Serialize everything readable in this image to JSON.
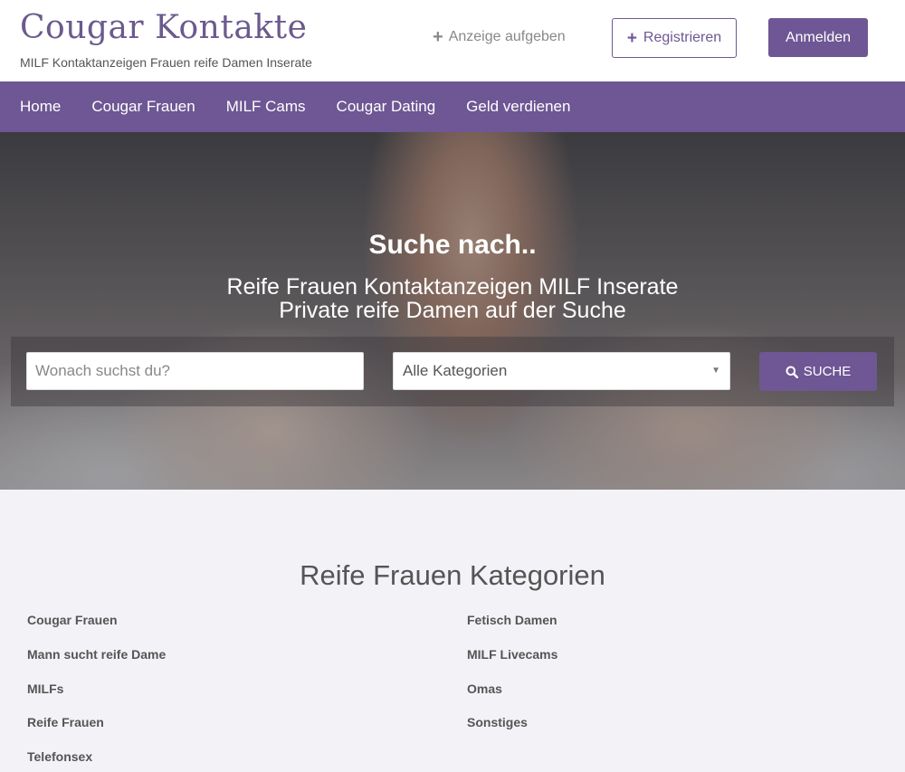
{
  "header": {
    "title": "Cougar Kontakte",
    "tagline": "MILF Kontaktanzeigen Frauen reife Damen Inserate",
    "post_ad_label": "Anzeige aufgeben",
    "register_label": "Registrieren",
    "login_label": "Anmelden"
  },
  "nav": {
    "items": [
      "Home",
      "Cougar Frauen",
      "MILF Cams",
      "Cougar Dating",
      "Geld verdienen"
    ]
  },
  "hero": {
    "title": "Suche nach..",
    "line1": "Reife Frauen Kontaktanzeigen MILF Inserate",
    "line2": "Private reife Damen auf der Suche",
    "search_placeholder": "Wonach suchst du?",
    "category_selected": "Alle Kategorien",
    "search_button": "SUCHE"
  },
  "categories": {
    "heading": "Reife Frauen Kategorien",
    "left": [
      "Cougar Frauen",
      "Mann sucht reife Dame",
      "MILFs",
      "Reife Frauen",
      "Telefonsex"
    ],
    "right": [
      "Fetisch Damen",
      "MILF Livecams",
      "Omas",
      "Sonstiges"
    ]
  },
  "colors": {
    "accent": "#6e5794",
    "brand_text": "#6b5a8e"
  }
}
